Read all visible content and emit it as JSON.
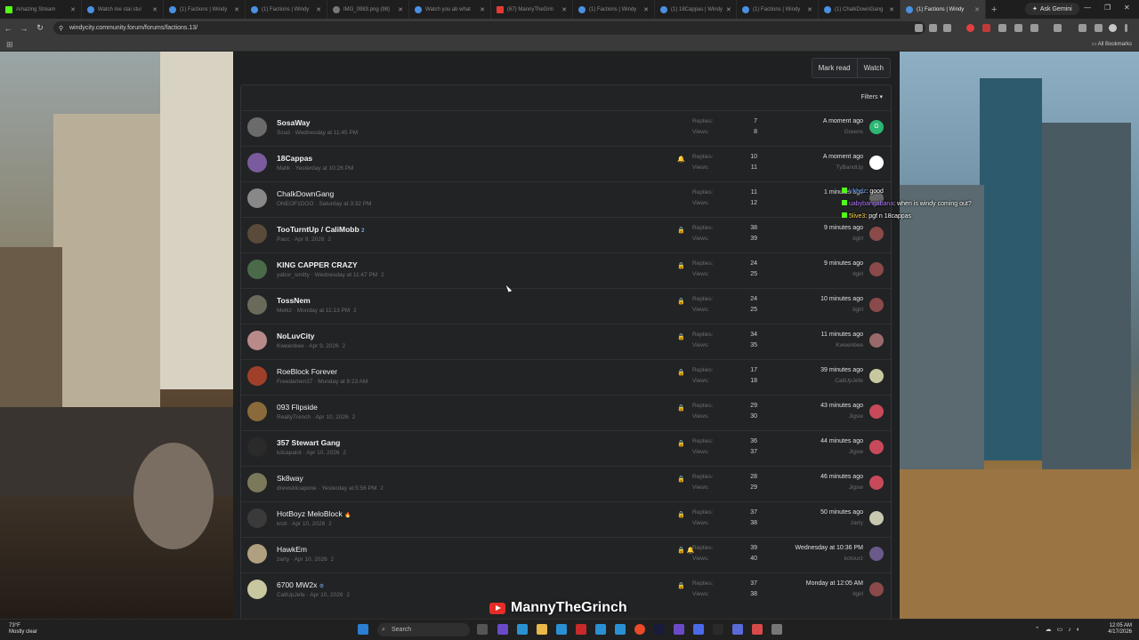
{
  "browser": {
    "tabs": [
      {
        "label": "Amazing Stream",
        "active": false
      },
      {
        "label": "Watch me stai stui",
        "active": false
      },
      {
        "label": "(1) Factions | Windy",
        "active": false
      },
      {
        "label": "(1) Factions | Windy",
        "active": false
      },
      {
        "label": "IMG_0983.png (98)",
        "active": false
      },
      {
        "label": "Watch you ab what",
        "active": false
      },
      {
        "label": "(67) MannyTheGrin",
        "active": false
      },
      {
        "label": "(1) Factions | Windy",
        "active": false
      },
      {
        "label": "(1) 18Cappas | Windy",
        "active": false
      },
      {
        "label": "(1) Factions | Windy",
        "active": false
      },
      {
        "label": "(1) ChalkDownGang",
        "active": false
      },
      {
        "label": "(1) Factions | Windy",
        "active": true
      }
    ],
    "ask_gemini": "Ask Gemini",
    "url": "windycity.community.forum/forums/factions.13/",
    "all_bookmarks": "All Bookmarks"
  },
  "forum": {
    "mark_read": "Mark read",
    "watch": "Watch",
    "filters": "Filters",
    "replies_label": "Replies:",
    "views_label": "Views:",
    "threads": [
      {
        "title": "SosaWay",
        "author": "Scud",
        "date": "Wednesday at 11:45 PM",
        "pages": "",
        "replies": "7",
        "views": "8",
        "last_time": "A moment ago",
        "last_user": "Greens",
        "icons": "",
        "bold": true,
        "avatar_color": "#6b6b6b",
        "mini_color": "#2bb673",
        "mini_text": "G",
        "title_suffix": ""
      },
      {
        "title": "18Cappas",
        "author": "Malik",
        "date": "Yesterday at 10:26 PM",
        "pages": "",
        "replies": "10",
        "views": "11",
        "last_time": "A moment ago",
        "last_user": "TyBandUp",
        "icons": "🔔",
        "bold": true,
        "avatar_color": "#7a5c9e",
        "mini_color": "#ffffff",
        "mini_text": "",
        "title_suffix": ""
      },
      {
        "title": "ChalkDownGang",
        "author": "ONEOF1DOO",
        "date": "Saturday at 3:32 PM",
        "pages": "",
        "replies": "11",
        "views": "12",
        "last_time": "1 minutes ago",
        "last_user": "",
        "icons": "",
        "bold": false,
        "avatar_color": "#888888",
        "mini_color": "#666666",
        "mini_text": "",
        "title_suffix": ""
      },
      {
        "title": "TooTurntUp / CaliMobb",
        "author": "Pacc",
        "date": "Apr 9, 2026",
        "pages": "2",
        "replies": "38",
        "views": "39",
        "last_time": "9 minutes ago",
        "last_user": "itgirl",
        "icons": "🔒",
        "bold": true,
        "avatar_color": "#5a4a3a",
        "mini_color": "#8a4a4a",
        "mini_text": "",
        "title_suffix": "2"
      },
      {
        "title": "KING CAPPER CRAZY",
        "author": "yabor_smitty",
        "date": "Wednesday at 11:47 PM",
        "pages": "2",
        "replies": "24",
        "views": "25",
        "last_time": "9 minutes ago",
        "last_user": "itgirl",
        "icons": "🔒",
        "bold": true,
        "avatar_color": "#4a6a4a",
        "mini_color": "#8a4a4a",
        "mini_text": "",
        "title_suffix": ""
      },
      {
        "title": "TossNem",
        "author": "Melkz",
        "date": "Monday at 11:13 PM",
        "pages": "2",
        "replies": "24",
        "views": "25",
        "last_time": "10 minutes ago",
        "last_user": "itgirl",
        "icons": "🔒",
        "bold": true,
        "avatar_color": "#6a6a5a",
        "mini_color": "#8a4a4a",
        "mini_text": "",
        "title_suffix": ""
      },
      {
        "title": "NoLuvCity",
        "author": "Kweenbee",
        "date": "Apr 9, 2026",
        "pages": "2",
        "replies": "34",
        "views": "35",
        "last_time": "11 minutes ago",
        "last_user": "Kweenbee",
        "icons": "🔒",
        "bold": true,
        "avatar_color": "#b88a8a",
        "mini_color": "#9a6a6a",
        "mini_text": "",
        "title_suffix": ""
      },
      {
        "title": "RoeBlock Forever",
        "author": "Freedamen37",
        "date": "Monday at 8:23 AM",
        "pages": "",
        "replies": "17",
        "views": "18",
        "last_time": "39 minutes ago",
        "last_user": "CallUpJefe",
        "icons": "🔒",
        "bold": false,
        "avatar_color": "#a0402a",
        "mini_color": "#c8c8a0",
        "mini_text": "",
        "title_suffix": ""
      },
      {
        "title": "093 Flipside",
        "author": "ReallyTrench",
        "date": "Apr 10, 2026",
        "pages": "2",
        "replies": "29",
        "views": "30",
        "last_time": "43 minutes ago",
        "last_user": "Jigsw",
        "icons": "🔒",
        "bold": false,
        "avatar_color": "#8a6a3a",
        "mini_color": "#c84a5a",
        "mini_text": "",
        "title_suffix": ""
      },
      {
        "title": "357 Stewart Gang",
        "author": "kdcapalot",
        "date": "Apr 10, 2026",
        "pages": "2",
        "replies": "36",
        "views": "37",
        "last_time": "44 minutes ago",
        "last_user": "Jigsw",
        "icons": "🔒",
        "bold": true,
        "avatar_color": "#2a2a2a",
        "mini_color": "#c84a5a",
        "mini_text": "",
        "title_suffix": ""
      },
      {
        "title": "Sk8way",
        "author": "drewskiicapone",
        "date": "Yesterday at 5:56 PM",
        "pages": "2",
        "replies": "28",
        "views": "29",
        "last_time": "46 minutes ago",
        "last_user": "Jigsw",
        "icons": "🔒",
        "bold": false,
        "avatar_color": "#7a7a5a",
        "mini_color": "#c84a5a",
        "mini_text": "",
        "title_suffix": ""
      },
      {
        "title": "HotBoyz MeloBlock",
        "author": "knzl",
        "date": "Apr 10, 2026",
        "pages": "2",
        "replies": "37",
        "views": "38",
        "last_time": "50 minutes ago",
        "last_user": "zarty",
        "icons": "🔒",
        "bold": false,
        "avatar_color": "#3a3a3a",
        "mini_color": "#c8c8b0",
        "mini_text": "",
        "title_suffix": "🔥"
      },
      {
        "title": "HawkEm",
        "author": "zarty",
        "date": "Apr 10, 2026",
        "pages": "2",
        "replies": "39",
        "views": "40",
        "last_time": "Wednesday at 10:36 PM",
        "last_user": "kotourz",
        "icons": "🔒 🔔",
        "bold": false,
        "avatar_color": "#b0a080",
        "mini_color": "#6a5a8a",
        "mini_text": "",
        "title_suffix": ""
      },
      {
        "title": "6700 MW2x",
        "author": "CallUpJefe",
        "date": "Apr 10, 2026",
        "pages": "2",
        "replies": "37",
        "views": "38",
        "last_time": "Monday at 12:05 AM",
        "last_user": "itgirl",
        "icons": "🔒",
        "bold": false,
        "avatar_color": "#c8c8a0",
        "mini_color": "#8a4a4a",
        "mini_text": "",
        "title_suffix": "⚙"
      }
    ]
  },
  "chat": [
    {
      "user": "Vkhdz",
      "message": "good",
      "color": "#6aa8ff"
    },
    {
      "user": "uabybangabana",
      "message": "when is windy coming out?",
      "color": "#b07aff"
    },
    {
      "user": "5live3",
      "message": "pgf n 18cappas",
      "color": "#ffd24a"
    }
  ],
  "overlay": {
    "channel": "MannyTheGrinch"
  },
  "taskbar": {
    "temp": "73°F",
    "weather": "Mostly clear",
    "search": "Search",
    "time": "12:05 AM",
    "date": "4/17/2026"
  }
}
